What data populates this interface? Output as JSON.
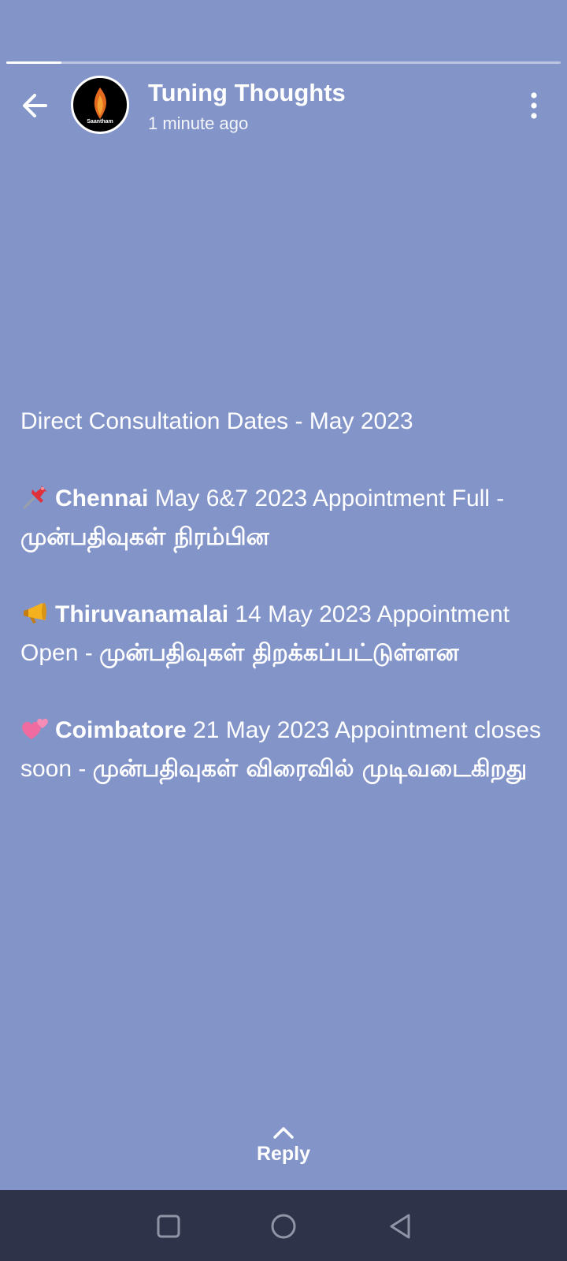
{
  "story": {
    "progress": 0.1,
    "account_name": "Tuning Thoughts",
    "posted_time": "1 minute ago",
    "avatar_brand": "Saantham",
    "background_color": "#8394c9",
    "icons": {
      "back": "arrow-left-icon",
      "menu": "more-vertical-icon",
      "reply": "chevron-up-icon"
    }
  },
  "post": {
    "heading": "Direct Consultation Dates - May 2023",
    "entries": [
      {
        "emoji": "pushpin-icon",
        "city": "Chennai",
        "details": " May 6&7 2023 Appointment Full - ",
        "tamil": "முன்பதிவுகள் நிரம்பின"
      },
      {
        "emoji": "megaphone-icon",
        "city": "Thiruvanamalai",
        "details": " 14 May 2023 Appointment Open - ",
        "tamil": "முன்பதிவுகள் திறக்கப்பட்டுள்ளன"
      },
      {
        "emoji": "two-hearts-icon",
        "city": "Coimbatore",
        "details": " 21 May 2023 Appointment closes soon - ",
        "tamil": "முன்பதிவுகள் விரைவில் முடிவடைகிறது"
      }
    ]
  },
  "reply": {
    "label": "Reply"
  },
  "navbar": {
    "color": "#2e3349",
    "buttons": [
      "recent-apps-icon",
      "home-icon",
      "back-triangle-icon"
    ]
  }
}
